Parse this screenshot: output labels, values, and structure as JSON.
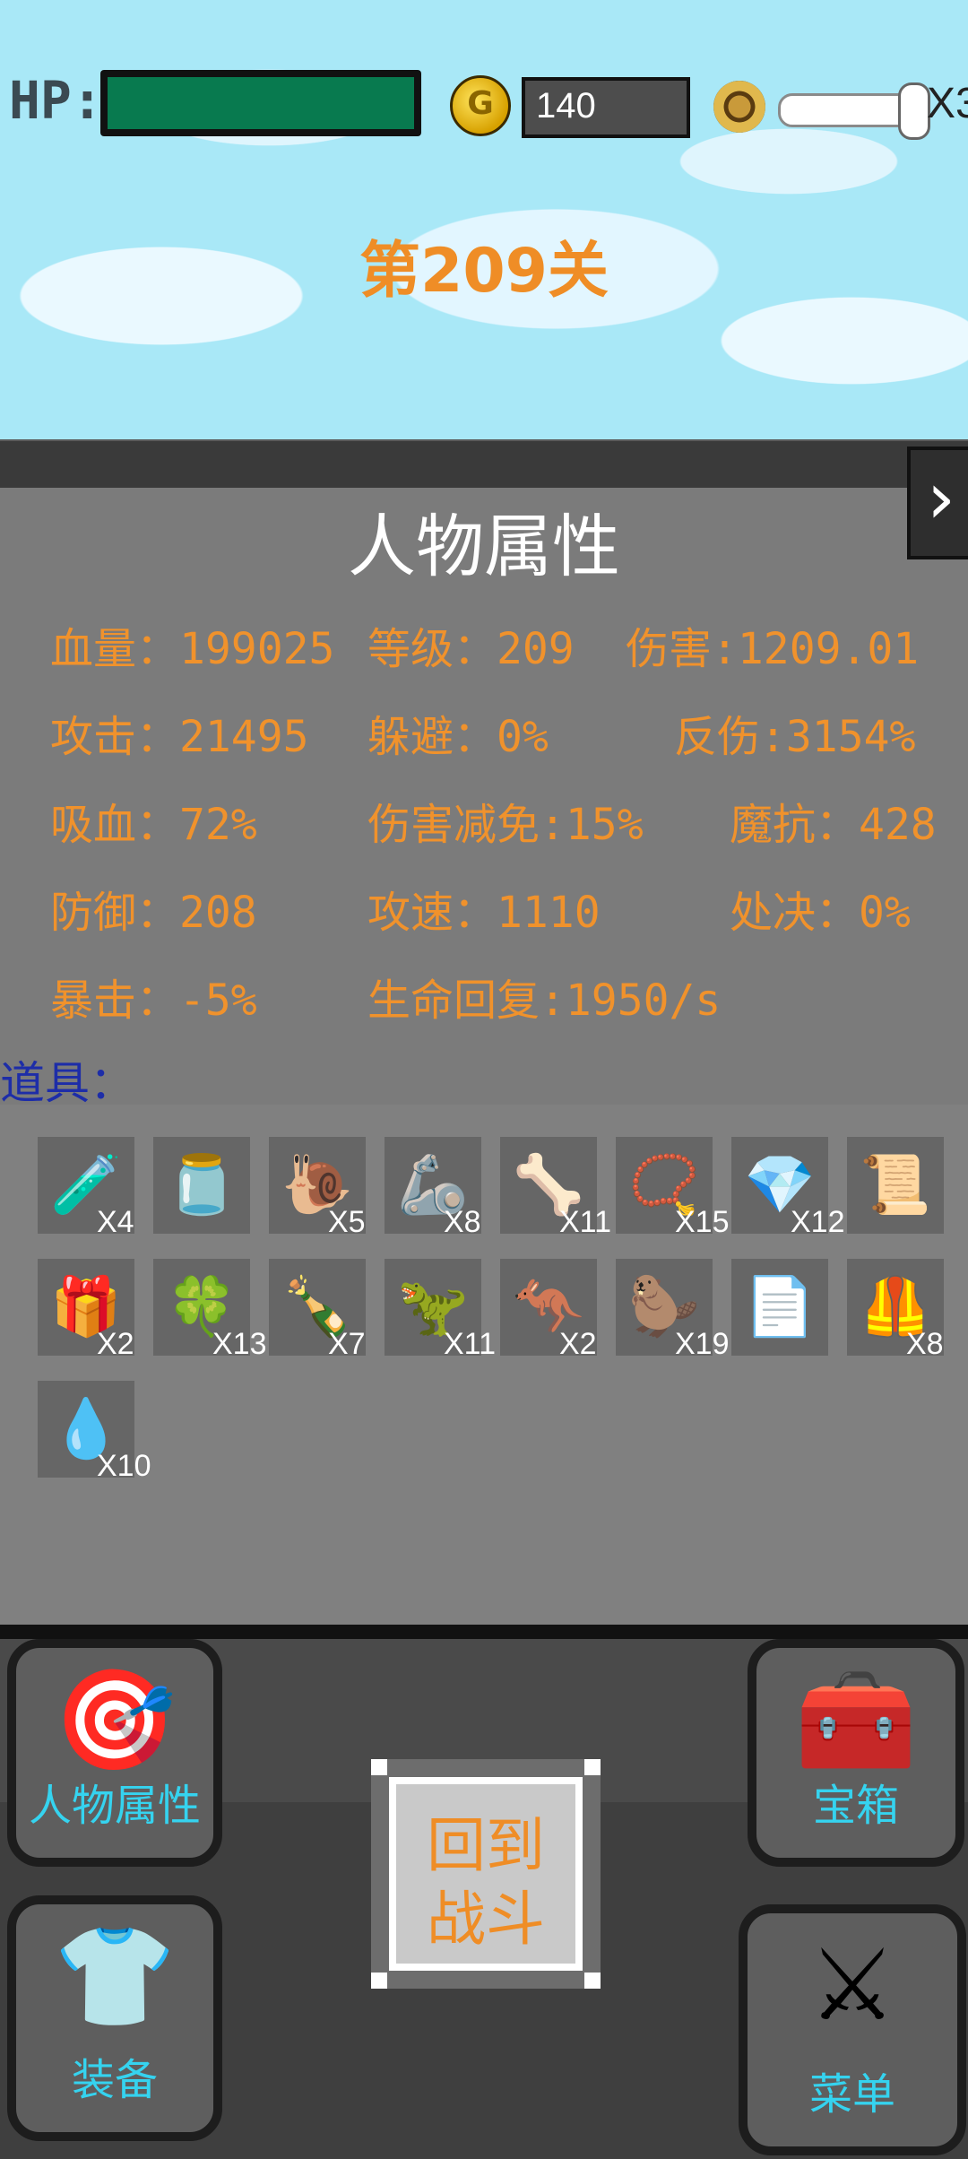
{
  "hud": {
    "hp_label": "HP:",
    "hp_fraction": 1.0,
    "coins": "140",
    "speed_label": "X3",
    "speed_fraction": 0.95
  },
  "level_title": "第209关",
  "attributes": {
    "title": "人物属性",
    "close_icon": "›",
    "stats": [
      "血量：199025",
      "等级：209",
      "伤害:1209.01",
      "攻击：21495",
      "躲避：0%",
      "反伤:3154%",
      "吸血：72%",
      "伤害减免:15%",
      "魔抗：428",
      "防御：208",
      "攻速：1110",
      "处决：0%",
      "暴击：-5%",
      "生命回复:1950/s"
    ]
  },
  "items": {
    "label": "道具：",
    "list": [
      {
        "icon": "🧪",
        "name": "red-potion",
        "qty": "X4"
      },
      {
        "icon": "🫙",
        "name": "green-jar",
        "qty": ""
      },
      {
        "icon": "🐌",
        "name": "snail",
        "qty": "X5"
      },
      {
        "icon": "🦾",
        "name": "gauntlet",
        "qty": "X8"
      },
      {
        "icon": "🦴",
        "name": "golden-claw",
        "qty": "X11"
      },
      {
        "icon": "📿",
        "name": "emerald-necklace",
        "qty": "X15"
      },
      {
        "icon": "💎",
        "name": "ruby-necklace",
        "qty": "X12"
      },
      {
        "icon": "📜",
        "name": "scroll",
        "qty": ""
      },
      {
        "icon": "🎁",
        "name": "gift-box",
        "qty": "X2"
      },
      {
        "icon": "🍀",
        "name": "clover",
        "qty": "X13"
      },
      {
        "icon": "🍾",
        "name": "green-bottle",
        "qty": "X7"
      },
      {
        "icon": "🦖",
        "name": "pink-dino",
        "qty": "X11"
      },
      {
        "icon": "🦘",
        "name": "green-kangaroo",
        "qty": "X2"
      },
      {
        "icon": "🦫",
        "name": "brown-beast",
        "qty": "X19"
      },
      {
        "icon": "📄",
        "name": "paper",
        "qty": ""
      },
      {
        "icon": "🦺",
        "name": "armor",
        "qty": "X8"
      },
      {
        "icon": "💧",
        "name": "green-gem",
        "qty": "X10"
      }
    ]
  },
  "nav": {
    "attributes": "人物属性",
    "chest": "宝箱",
    "equipment": "装备",
    "menu": "菜单",
    "back_to_battle": "回到\n战斗"
  }
}
